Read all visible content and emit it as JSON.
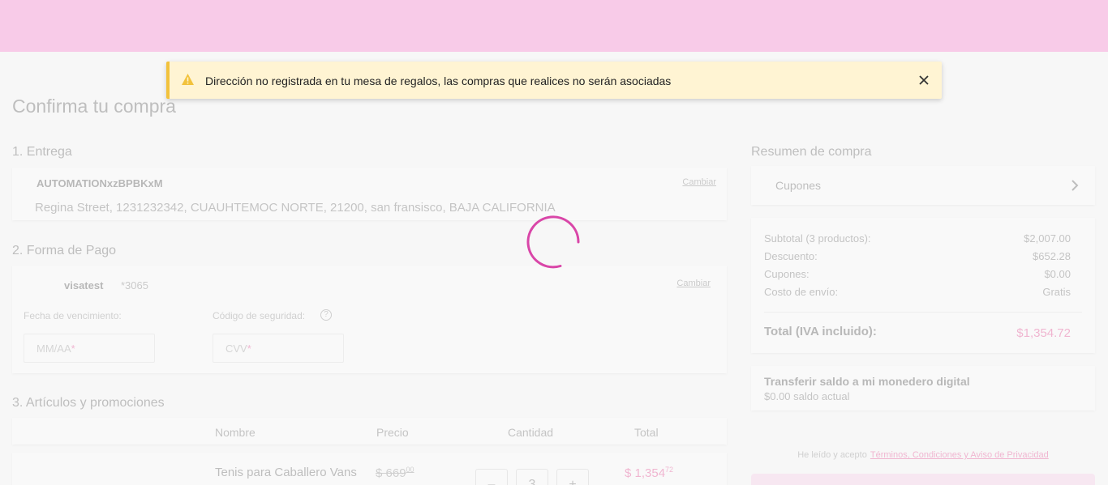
{
  "colors": {
    "header_bg": "#f8cbe8",
    "accent": "#e43d8a",
    "alert_bg": "#fff4d3",
    "alert_border": "#f2c23c",
    "button_bg": "#f8cbe8"
  },
  "alert": {
    "icon": "warning-icon",
    "message": "Dirección no registrada en tu mesa de regalos, las compras que realices no serán asociadas",
    "close_icon": "close-icon"
  },
  "page": {
    "title": "Confirma tu compra"
  },
  "delivery": {
    "section_title": "1. Entrega",
    "name": "AUTOMATIONxzBPBKxM",
    "change_label": "Cambiar",
    "address": "Regina Street, 1231232342, CUAUHTEMOC NORTE, 21200, san fransisco, BAJA CALIFORNIA"
  },
  "payment": {
    "section_title": "2. Forma de Pago",
    "card_brand": "visatest",
    "card_last": "*3065",
    "change_label": "Cambiar",
    "expiry_label": "Fecha de vencimiento:",
    "expiry_placeholder": "MM/AA",
    "security_label": "Código de seguridad:",
    "cvv_placeholder": "CVV",
    "required_mark": "*",
    "help_icon_glyph": "?"
  },
  "items": {
    "section_title": "3. Artículos y promociones",
    "headers": [
      "Nombre",
      "Precio",
      "Cantidad",
      "Total"
    ],
    "rows": [
      {
        "name": "Tenis para Caballero Vans",
        "old_price": "$ 669",
        "old_price_cents": "00",
        "quantity": "3",
        "total": "$ 1,354",
        "total_cents": "72",
        "minus_glyph": "–",
        "plus_glyph": "+"
      }
    ]
  },
  "summary": {
    "section_title": "Resumen de compra",
    "coupons_label": "Cupones",
    "rows": [
      {
        "label": "Subtotal (3 productos):",
        "value": "$2,007.00"
      },
      {
        "label": "Descuento:",
        "value": "$652.28"
      },
      {
        "label": "Cupones:",
        "value": "$0.00"
      },
      {
        "label": "Costo de envío:",
        "value": "Gratis"
      }
    ],
    "total_label": "Total (IVA incluido):",
    "total_value": "$1,354.72",
    "wallet_title": "Transferir saldo a mi monedero digital",
    "wallet_balance": "$0.00 saldo actual"
  },
  "terms": {
    "prefix": "He leído y acepto",
    "link": "Términos, Condiciones y Aviso de Privacidad"
  }
}
